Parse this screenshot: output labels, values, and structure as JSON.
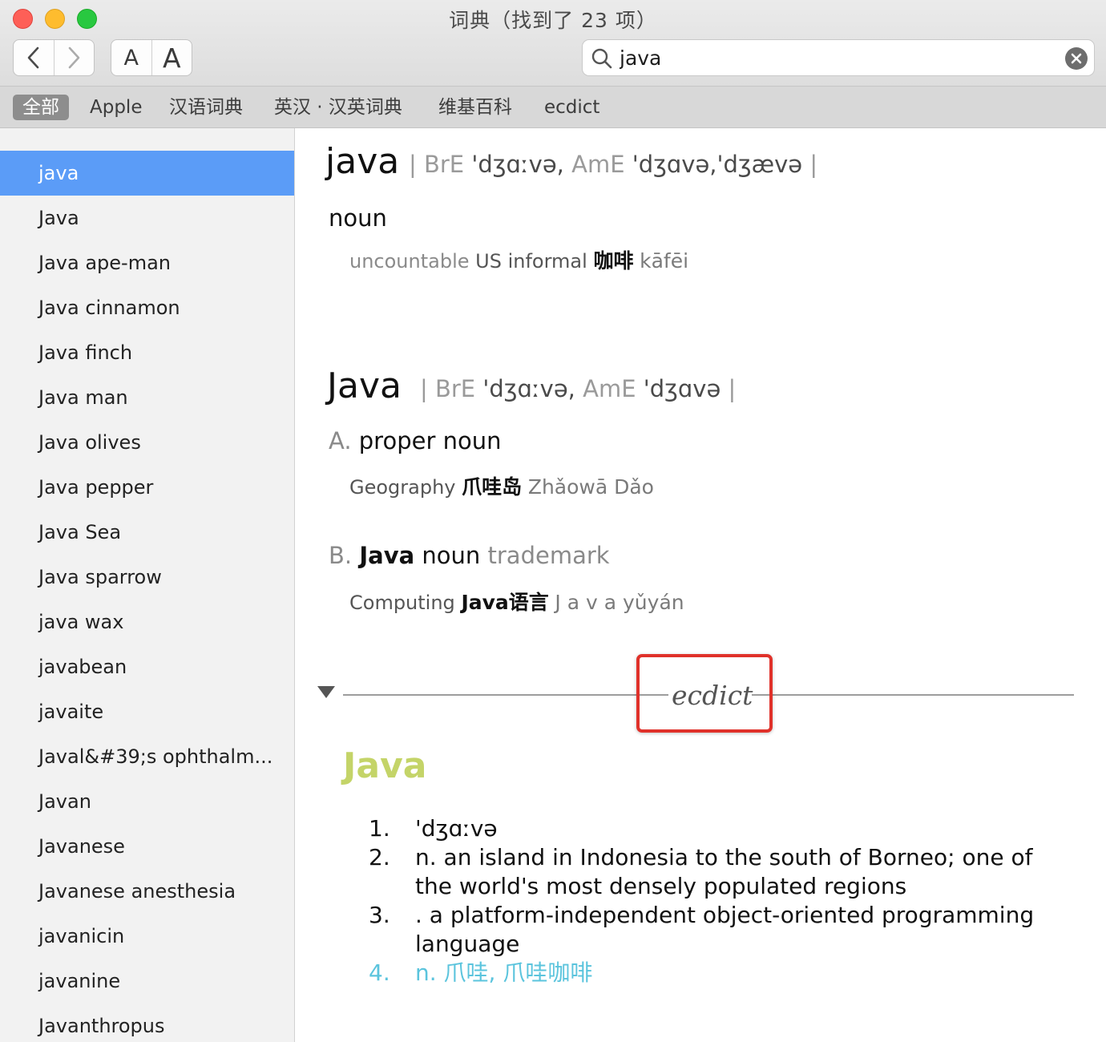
{
  "window": {
    "title": "词典（找到了 23 项）"
  },
  "toolbar": {
    "font_small": "A",
    "font_large": "A"
  },
  "search": {
    "value": "java",
    "placeholder": ""
  },
  "scopes": [
    "全部",
    "Apple",
    "汉语词典",
    "英汉 · 汉英词典",
    "维基百科",
    "ecdict"
  ],
  "sidebar": {
    "items": [
      "java",
      "Java",
      "Java ape-man",
      "Java cinnamon",
      "Java finch",
      "Java man",
      "Java olives",
      "Java pepper",
      "Java Sea",
      "Java sparrow",
      "java wax",
      "javabean",
      "javaite",
      "Javal&#39;s ophthalm...",
      "Javan",
      "Javanese",
      "Javanese anesthesia",
      "javanicin",
      "javanine",
      "Javanthropus"
    ]
  },
  "entry1": {
    "headword": "java",
    "bre_label": "| BrE",
    "bre": "'dʒɑːvə,",
    "ame_label": "AmE",
    "ame": "'dʒɑvə,'dʒævə",
    "end": "|",
    "pos": "noun",
    "sense_label": "uncountable",
    "sense_region": "US informal",
    "sense_zh": "咖啡",
    "sense_py": "kāfēi"
  },
  "entry2": {
    "headword": "Java",
    "bre_label": "| BrE",
    "bre": "'dʒɑːvə,",
    "ame_label": "AmE",
    "ame": "'dʒɑvə",
    "end": "|",
    "a_letter": "A.",
    "a_pos": "proper noun",
    "a_label": "Geography",
    "a_zh": "爪哇岛",
    "a_py": "Zhǎowā Dǎo",
    "b_letter": "B.",
    "b_word": "Java",
    "b_pos": "noun",
    "b_tm": "trademark",
    "b_label": "Computing",
    "b_zh": "Java语言",
    "b_py": "J a v a yǔyán"
  },
  "ecdict": {
    "dict_name": "ecdict",
    "headword": "Java",
    "definitions": [
      {
        "num": "1.",
        "text": " 'dʒɑːvə"
      },
      {
        "num": "2.",
        "text": "n. an island in Indonesia to the south of Borneo; one of the world's most densely populated regions"
      },
      {
        "num": "3.",
        "text": ". a platform-independent object-oriented programming language"
      },
      {
        "num": "4.",
        "text": " n. 爪哇, 爪哇咖啡"
      }
    ]
  },
  "colors": {
    "selection": "#5b9cf7",
    "ecdict_headword": "#c4d468",
    "ecdict_chinese": "#5bc4dd",
    "highlight_box": "#e0312a"
  }
}
